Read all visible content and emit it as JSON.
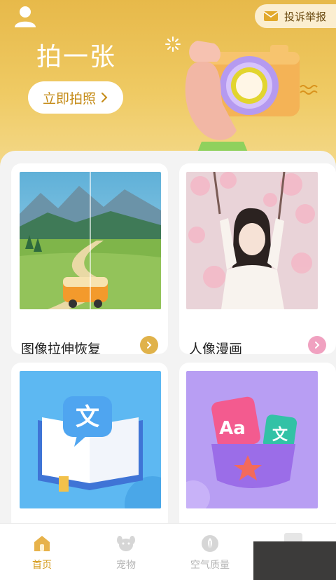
{
  "header": {
    "report_label": "投诉举报",
    "hero_title": "拍一张",
    "shoot_button_label": "立即拍照",
    "user_icon": "user-icon",
    "report_icon": "envelope-icon"
  },
  "cards": [
    {
      "label": "图像拉伸恢复",
      "image": "landscape-van-illustration",
      "arrow_color": "#e0b24a"
    },
    {
      "label": "人像漫画",
      "image": "girl-cherry-blossom-photo",
      "arrow_color": "#f0a1c0"
    },
    {
      "label": "",
      "image": "translate-book-illustration"
    },
    {
      "label": "",
      "image": "alphabet-cards-illustration"
    }
  ],
  "tabbar": {
    "items": [
      {
        "label": "首页",
        "icon": "home-icon",
        "active": true
      },
      {
        "label": "宠物",
        "icon": "pet-icon",
        "active": false
      },
      {
        "label": "空气质量",
        "icon": "leaf-icon",
        "active": false
      }
    ]
  },
  "colors": {
    "brand_yellow": "#e7b94a",
    "active_tab": "#d49a1a",
    "inactive_tab": "#b5b5b5"
  }
}
